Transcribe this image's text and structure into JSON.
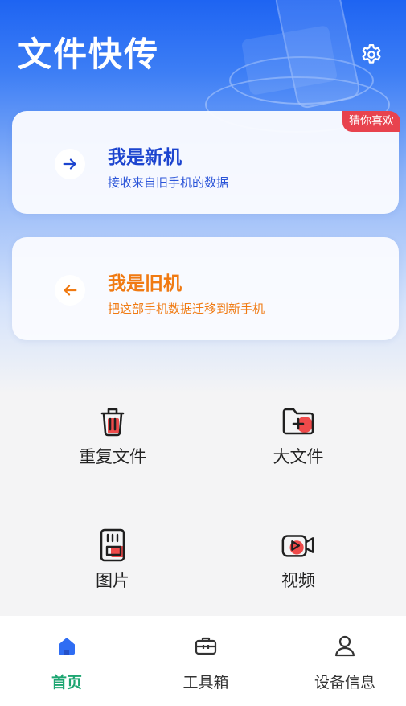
{
  "header": {
    "title": "文件快传",
    "settings_icon": "gear-icon"
  },
  "cards": {
    "new_phone": {
      "title": "我是新机",
      "subtitle": "接收来自旧手机的数据",
      "badge": "猜你喜欢",
      "icon": "arrow-right-icon",
      "color": "#1c44cf"
    },
    "old_phone": {
      "title": "我是旧机",
      "subtitle": "把这部手机数据迁移到新手机",
      "icon": "arrow-left-icon",
      "color": "#f07a12"
    }
  },
  "tools": [
    {
      "label": "重复文件",
      "icon": "trash-icon"
    },
    {
      "label": "大文件",
      "icon": "folder-plus-icon"
    },
    {
      "label": "图片",
      "icon": "sd-card-icon"
    },
    {
      "label": "视频",
      "icon": "video-camera-icon"
    }
  ],
  "tabbar": {
    "tabs": [
      {
        "label": "首页",
        "icon": "home-icon",
        "active": true
      },
      {
        "label": "工具箱",
        "icon": "toolbox-icon",
        "active": false
      },
      {
        "label": "设备信息",
        "icon": "person-icon",
        "active": false
      }
    ],
    "active_color": "#1ea672"
  },
  "colors": {
    "primary_blue": "#1e64f2",
    "accent_red": "#e8434e"
  }
}
